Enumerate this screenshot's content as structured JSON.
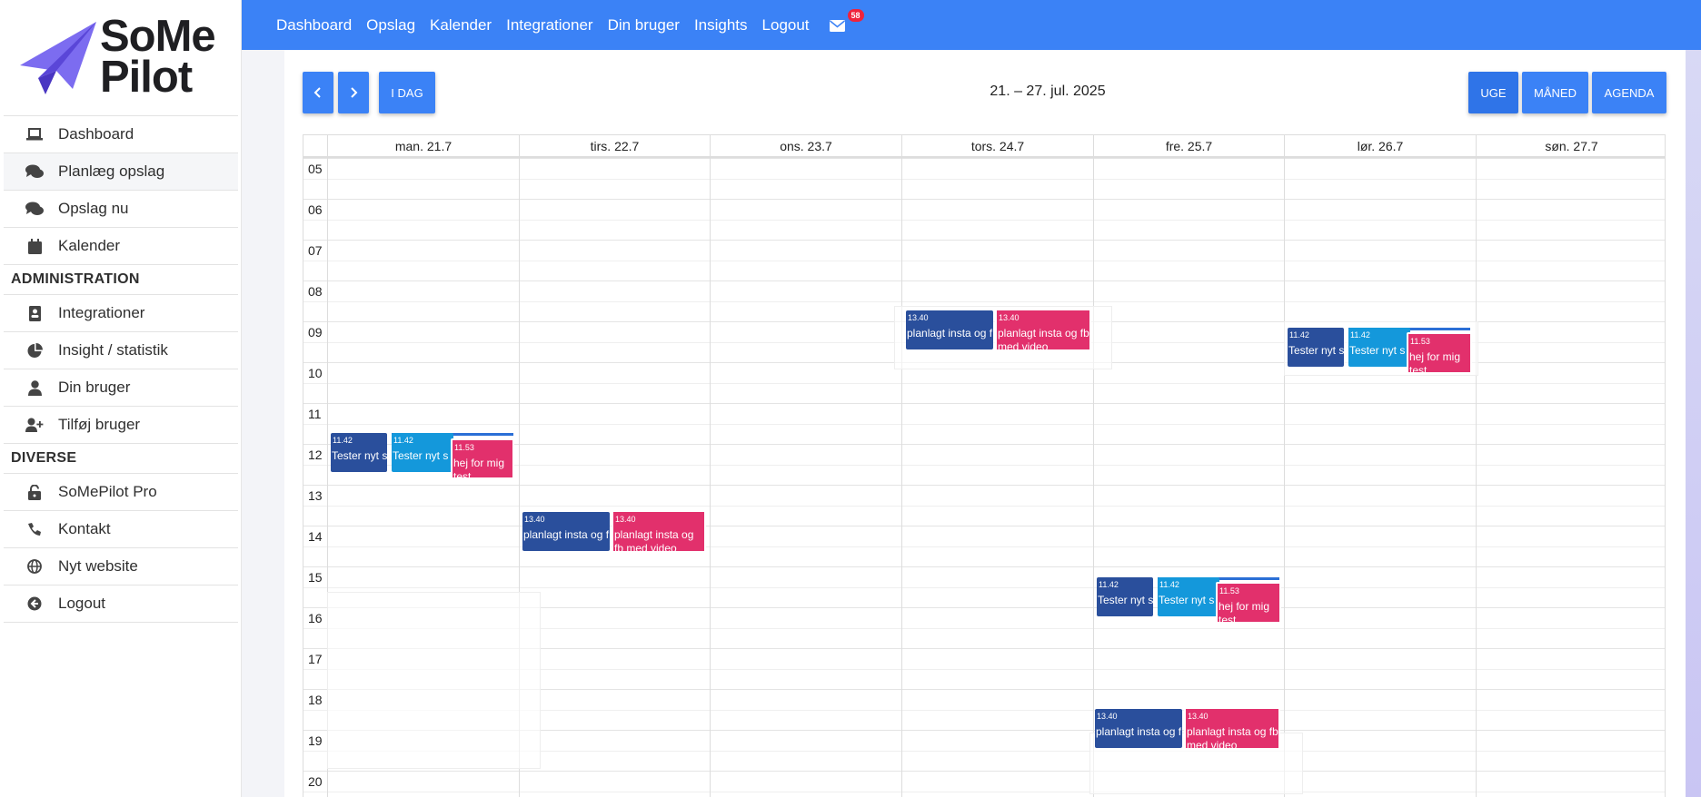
{
  "brand": {
    "line1": "SoMe",
    "line2": "Pilot"
  },
  "sidebar": {
    "items_top": [
      {
        "label": "Dashboard",
        "icon": "laptop-icon"
      },
      {
        "label": "Planlæg opslag",
        "icon": "comments-icon"
      },
      {
        "label": "Opslag nu",
        "icon": "comments-icon"
      },
      {
        "label": "Kalender",
        "icon": "calendar-icon"
      }
    ],
    "section_admin": "ADMINISTRATION",
    "items_admin": [
      {
        "label": "Integrationer",
        "icon": "address-card-icon"
      },
      {
        "label": "Insight / statistik",
        "icon": "pie-chart-icon"
      },
      {
        "label": "Din bruger",
        "icon": "user-icon"
      },
      {
        "label": "Tilføj bruger",
        "icon": "user-plus-icon"
      }
    ],
    "section_misc": "DIVERSE",
    "items_misc": [
      {
        "label": "SoMePilot Pro",
        "icon": "unlock-icon"
      },
      {
        "label": "Kontakt",
        "icon": "phone-icon"
      },
      {
        "label": "Nyt website",
        "icon": "globe-icon"
      },
      {
        "label": "Logout",
        "icon": "arrow-left-circle-icon"
      }
    ]
  },
  "topnav": {
    "items": [
      "Dashboard",
      "Opslag",
      "Kalender",
      "Integrationer",
      "Din bruger",
      "Insights",
      "Logout"
    ],
    "mail_badge": "58"
  },
  "toolbar": {
    "prev_icon": "chevron-left-icon",
    "next_icon": "chevron-right-icon",
    "today": "I DAG",
    "range": "21. – 27. jul. 2025",
    "view_week": "UGE",
    "view_month": "MÅNED",
    "view_agenda": "AGENDA"
  },
  "calendar": {
    "days": [
      "man. 21.7",
      "tirs. 22.7",
      "ons. 23.7",
      "tors. 24.7",
      "fre. 25.7",
      "lør. 26.7",
      "søn. 27.7"
    ],
    "hours": [
      "05",
      "06",
      "07",
      "08",
      "09",
      "10",
      "11",
      "12",
      "13",
      "14",
      "15",
      "16",
      "17",
      "18",
      "19",
      "20"
    ],
    "event_texts": {
      "t1": "11.42",
      "n1": "Tester nyt s",
      "t2": "11.42",
      "n2": "Tester nyt s",
      "t3": "11.53",
      "n3": "hej for mig test",
      "t4": "13.40",
      "n4": "planlagt insta og f",
      "t5": "13.40",
      "n5": "planlagt insta og fb med video"
    }
  },
  "colors": {
    "primary": "#3b82f6",
    "event_dark": "#2a4f9c",
    "event_sky": "#1498db",
    "event_pink": "#e2306c"
  }
}
